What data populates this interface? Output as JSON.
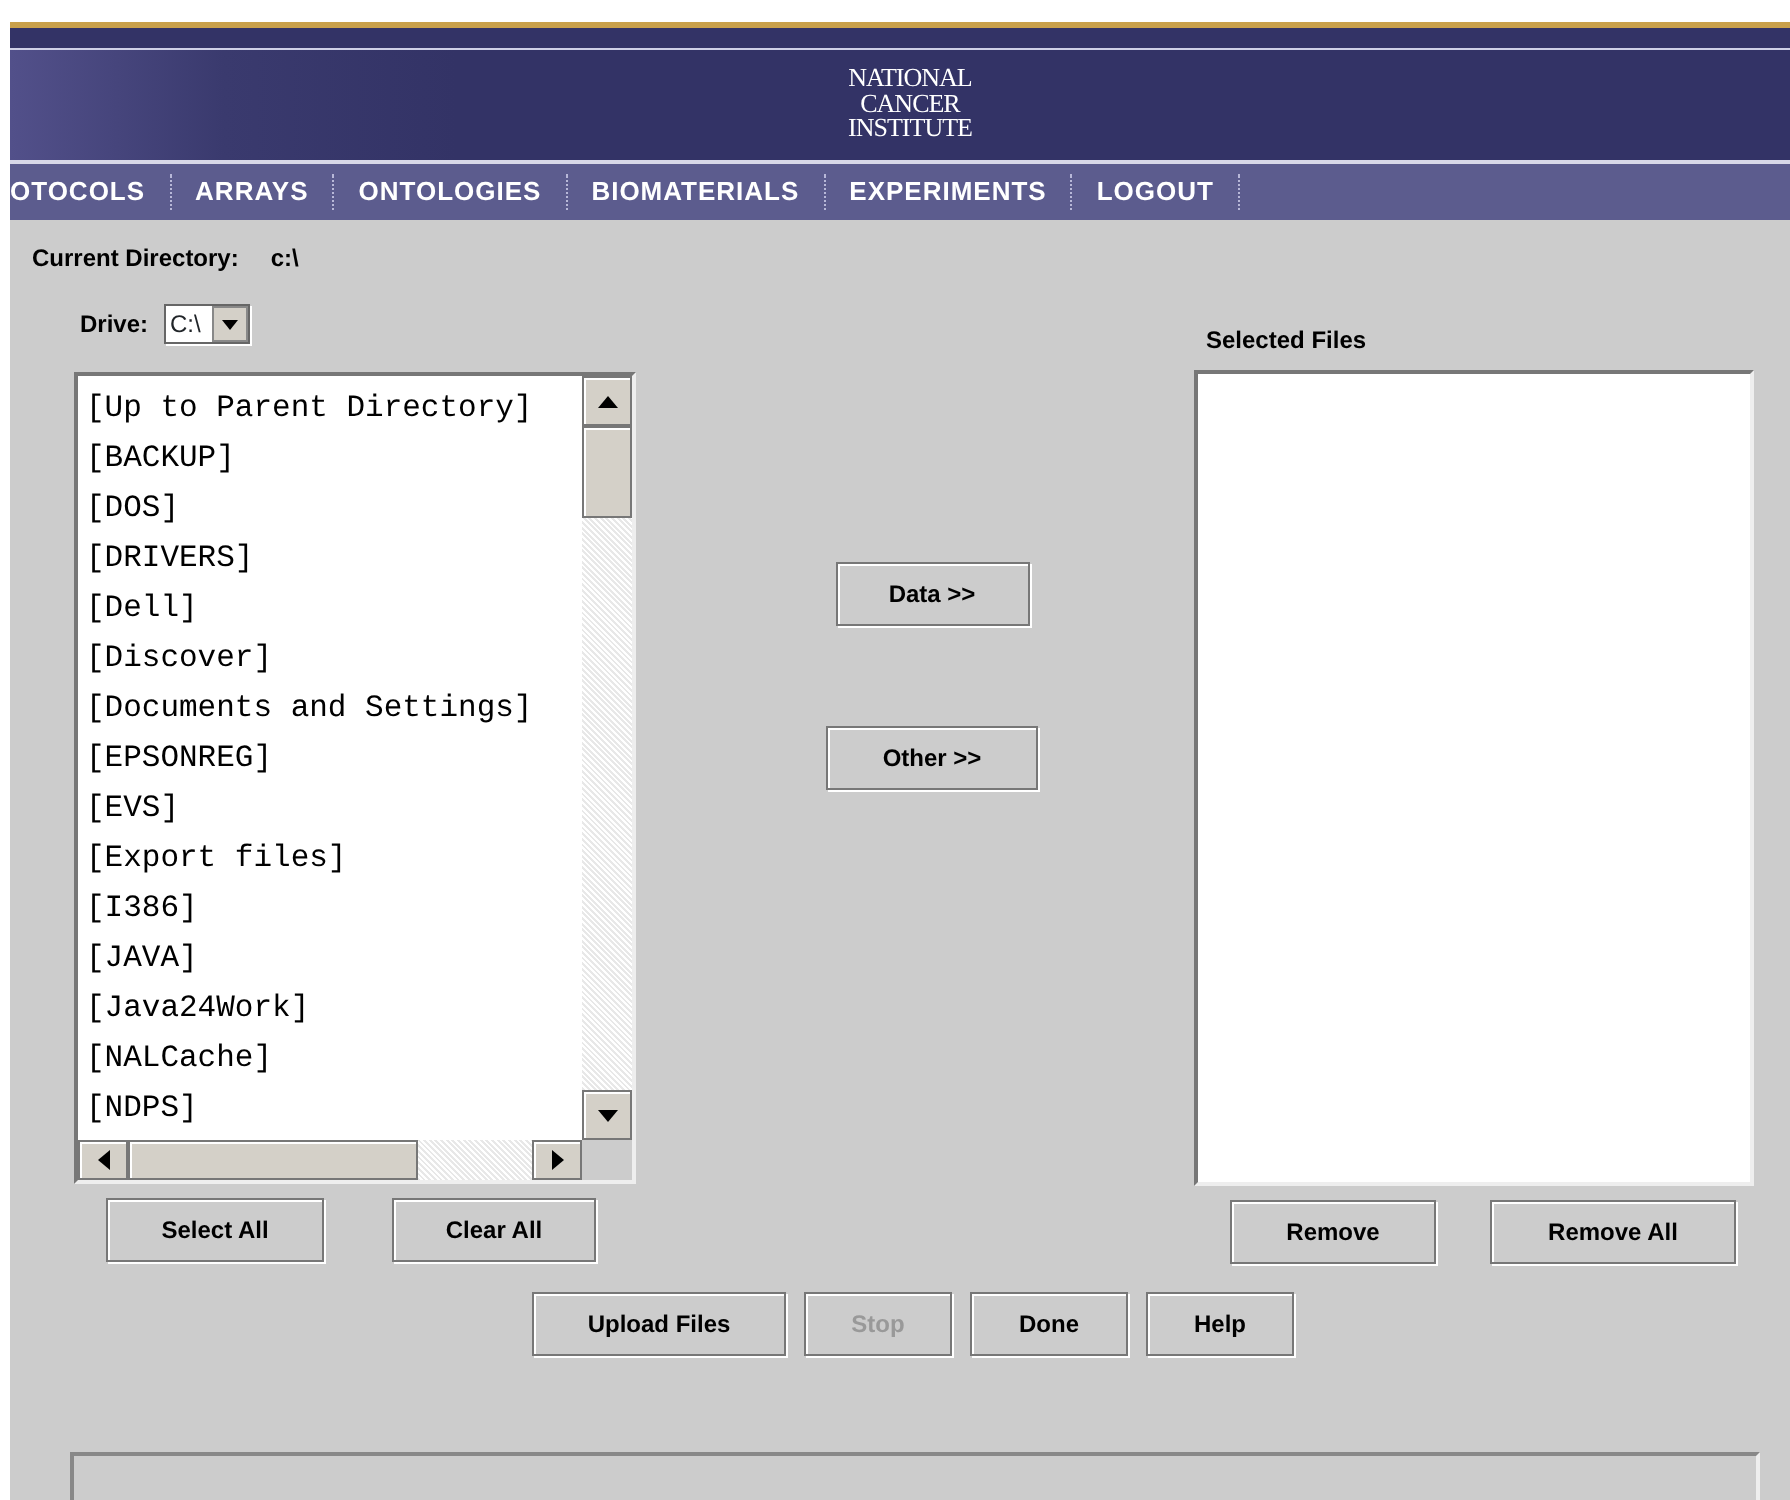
{
  "banner": {
    "logo_lines": [
      "NATIONAL",
      "CANCER",
      "INSTITUTE"
    ]
  },
  "nav": [
    "OTOCOLS",
    "ARRAYS",
    "ONTOLOGIES",
    "BIOMATERIALS",
    "EXPERIMENTS",
    "LOGOUT"
  ],
  "current_directory": {
    "label": "Current Directory:",
    "value": "c:\\"
  },
  "drive": {
    "label": "Drive:",
    "value": "C:\\"
  },
  "file_list": [
    "[Up to Parent Directory]",
    "[BACKUP]",
    "[DOS]",
    "[DRIVERS]",
    "[Dell]",
    "[Discover]",
    "[Documents and Settings]",
    "[EPSONREG]",
    "[EVS]",
    "[Export files]",
    "[I386]",
    "[JAVA]",
    "[Java24Work]",
    "[NALCache]",
    "[NDPS]"
  ],
  "transfer_buttons": [
    "Data >>",
    "Other >>"
  ],
  "selected_files": {
    "title": "Selected Files"
  },
  "left_buttons": [
    "Select All",
    "Clear All"
  ],
  "right_buttons": [
    "Remove",
    "Remove All"
  ],
  "action_buttons": [
    {
      "label": "Upload Files",
      "disabled": false
    },
    {
      "label": "Stop",
      "disabled": true
    },
    {
      "label": "Done",
      "disabled": false
    },
    {
      "label": "Help",
      "disabled": false
    }
  ]
}
